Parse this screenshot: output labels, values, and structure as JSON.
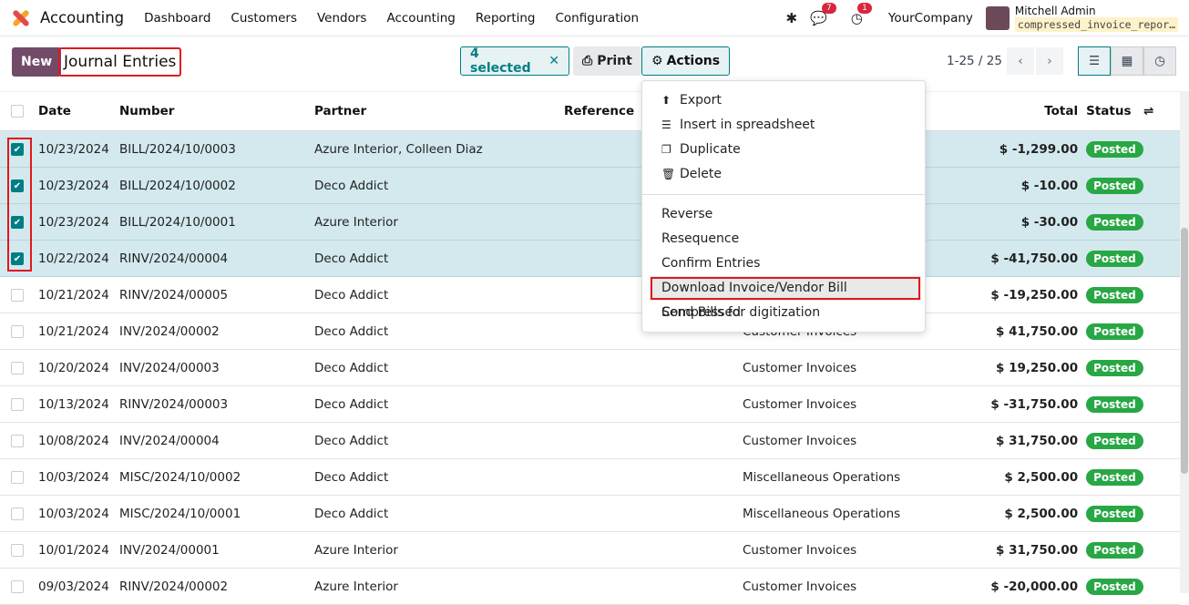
{
  "nav": {
    "app": "Accounting",
    "menus": [
      "Dashboard",
      "Customers",
      "Vendors",
      "Accounting",
      "Reporting",
      "Configuration"
    ],
    "messages_count": "7",
    "activity_count": "1",
    "company": "YourCompany",
    "user": "Mitchell Admin",
    "database": "compressed_invoice_repor…"
  },
  "control": {
    "new_label": "New",
    "title": "Journal Entries",
    "selected_label": "4 selected",
    "print_label": "Print",
    "actions_label": "Actions",
    "pager": "1-25 / 25"
  },
  "columns": {
    "date": "Date",
    "number": "Number",
    "partner": "Partner",
    "reference": "Reference",
    "total": "Total",
    "status": "Status"
  },
  "rows": [
    {
      "date": "10/23/2024",
      "number": "BILL/2024/10/0003",
      "partner": "Azure Interior, Colleen Diaz",
      "journal": "",
      "total": "$ -1,299.00",
      "status": "Posted",
      "selected": true
    },
    {
      "date": "10/23/2024",
      "number": "BILL/2024/10/0002",
      "partner": "Deco Addict",
      "journal": "",
      "total": "$ -10.00",
      "status": "Posted",
      "selected": true
    },
    {
      "date": "10/23/2024",
      "number": "BILL/2024/10/0001",
      "partner": "Azure Interior",
      "journal": "",
      "total": "$ -30.00",
      "status": "Posted",
      "selected": true
    },
    {
      "date": "10/22/2024",
      "number": "RINV/2024/00004",
      "partner": "Deco Addict",
      "journal": "",
      "total": "$ -41,750.00",
      "status": "Posted",
      "selected": true
    },
    {
      "date": "10/21/2024",
      "number": "RINV/2024/00005",
      "partner": "Deco Addict",
      "journal": "",
      "total": "$ -19,250.00",
      "status": "Posted",
      "selected": false
    },
    {
      "date": "10/21/2024",
      "number": "INV/2024/00002",
      "partner": "Deco Addict",
      "journal": "Customer Invoices",
      "total": "$ 41,750.00",
      "status": "Posted",
      "selected": false
    },
    {
      "date": "10/20/2024",
      "number": "INV/2024/00003",
      "partner": "Deco Addict",
      "journal": "Customer Invoices",
      "total": "$ 19,250.00",
      "status": "Posted",
      "selected": false
    },
    {
      "date": "10/13/2024",
      "number": "RINV/2024/00003",
      "partner": "Deco Addict",
      "journal": "Customer Invoices",
      "total": "$ -31,750.00",
      "status": "Posted",
      "selected": false
    },
    {
      "date": "10/08/2024",
      "number": "INV/2024/00004",
      "partner": "Deco Addict",
      "journal": "Customer Invoices",
      "total": "$ 31,750.00",
      "status": "Posted",
      "selected": false
    },
    {
      "date": "10/03/2024",
      "number": "MISC/2024/10/0002",
      "partner": "Deco Addict",
      "journal": "Miscellaneous Operations",
      "total": "$ 2,500.00",
      "status": "Posted",
      "selected": false
    },
    {
      "date": "10/03/2024",
      "number": "MISC/2024/10/0001",
      "partner": "Deco Addict",
      "journal": "Miscellaneous Operations",
      "total": "$ 2,500.00",
      "status": "Posted",
      "selected": false
    },
    {
      "date": "10/01/2024",
      "number": "INV/2024/00001",
      "partner": "Azure Interior",
      "journal": "Customer Invoices",
      "total": "$ 31,750.00",
      "status": "Posted",
      "selected": false
    },
    {
      "date": "09/03/2024",
      "number": "RINV/2024/00002",
      "partner": "Azure Interior",
      "journal": "Customer Invoices",
      "total": "$ -20,000.00",
      "status": "Posted",
      "selected": false
    }
  ],
  "dropdown": {
    "group1": [
      {
        "label": "Export",
        "icon": "upload-icon"
      },
      {
        "label": "Insert in spreadsheet",
        "icon": "list-icon"
      },
      {
        "label": "Duplicate",
        "icon": "copy-icon"
      },
      {
        "label": "Delete",
        "icon": "trash-icon"
      }
    ],
    "group2": [
      "Reverse",
      "Resequence",
      "Confirm Entries",
      "Download Invoice/Vendor Bill Compressed",
      "Send Bills for digitization"
    ]
  },
  "colors": {
    "brand": "#714b67",
    "accent": "#017e84",
    "posted": "#28a745",
    "highlight": "#e0181f"
  }
}
